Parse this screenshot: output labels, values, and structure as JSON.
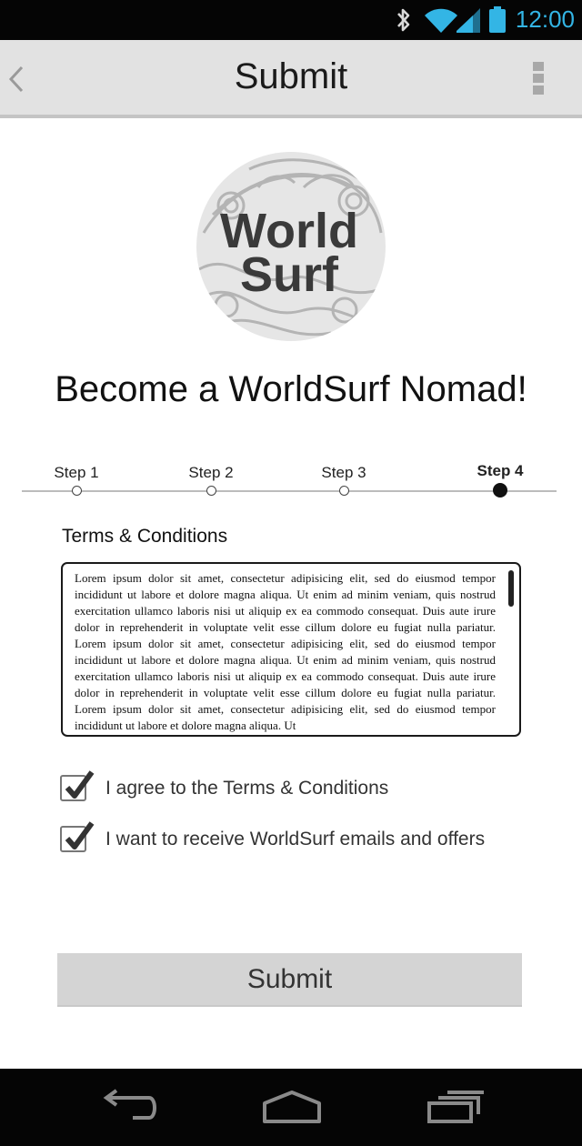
{
  "status_bar": {
    "time": "12:00"
  },
  "action_bar": {
    "title": "Submit"
  },
  "logo": {
    "line1": "World",
    "line2": "Surf"
  },
  "headline": "Become a WorldSurf Nomad!",
  "stepper": {
    "steps": [
      {
        "label": "Step 1"
      },
      {
        "label": "Step 2"
      },
      {
        "label": "Step 3"
      },
      {
        "label": "Step 4"
      }
    ],
    "current_step": 4
  },
  "terms": {
    "heading": "Terms & Conditions",
    "body": "Lorem ipsum dolor sit amet, consectetur adipisicing elit, sed do eiusmod tempor incididunt ut labore et dolore magna aliqua. Ut enim ad minim veniam, quis nostrud exercitation ullamco laboris nisi ut aliquip ex ea commodo consequat. Duis aute irure dolor in reprehenderit in voluptate velit esse cillum dolore eu fugiat nulla pariatur. Lorem ipsum dolor sit amet, consectetur adipisicing elit, sed do eiusmod tempor incididunt ut labore et dolore magna aliqua. Ut enim ad minim veniam, quis nostrud exercitation ullamco laboris nisi ut aliquip ex ea commodo consequat. Duis aute irure dolor in reprehenderit in voluptate velit esse cillum dolore eu fugiat nulla pariatur. Lorem ipsum dolor sit amet, consectetur adipisicing elit, sed do eiusmod tempor incididunt ut labore et dolore magna aliqua. Ut"
  },
  "checkboxes": [
    {
      "label": "I agree to the Terms & Conditions",
      "checked": true
    },
    {
      "label": "I want to receive WorldSurf emails and offers",
      "checked": true
    }
  ],
  "submit_button": {
    "label": "Submit"
  },
  "colors": {
    "status_accent": "#33b5e5",
    "bar_background": "#e2e2e2",
    "button_background": "#d4d4d4"
  },
  "icons": [
    "bluetooth-icon",
    "wifi-icon",
    "signal-icon",
    "battery-icon",
    "back-chevron-icon",
    "overflow-menu-icon",
    "checkmark-icon",
    "nav-back-icon",
    "nav-home-icon",
    "nav-recents-icon"
  ]
}
